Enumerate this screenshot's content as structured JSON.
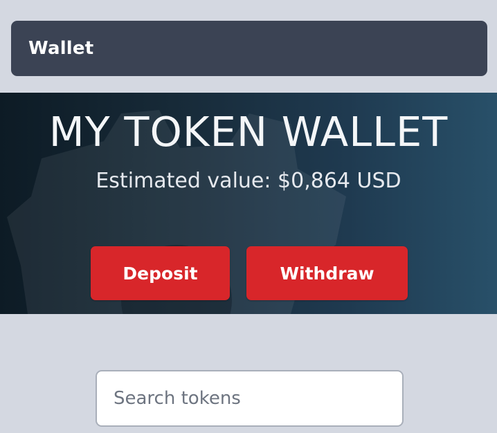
{
  "header": {
    "title": "Wallet"
  },
  "hero": {
    "title": "MY TOKEN WALLET",
    "estimated_value": "Estimated value: $0,864 USD",
    "background_icon": "gear-icon"
  },
  "actions": {
    "deposit_label": "Deposit",
    "withdraw_label": "Withdraw"
  },
  "search": {
    "placeholder": "Search tokens",
    "value": ""
  },
  "colors": {
    "page_background": "#d4d8e1",
    "header_background": "#3b4354",
    "accent": "#d8262a",
    "hero_gradient_start": "#0d1b25",
    "hero_gradient_end": "#285069"
  }
}
